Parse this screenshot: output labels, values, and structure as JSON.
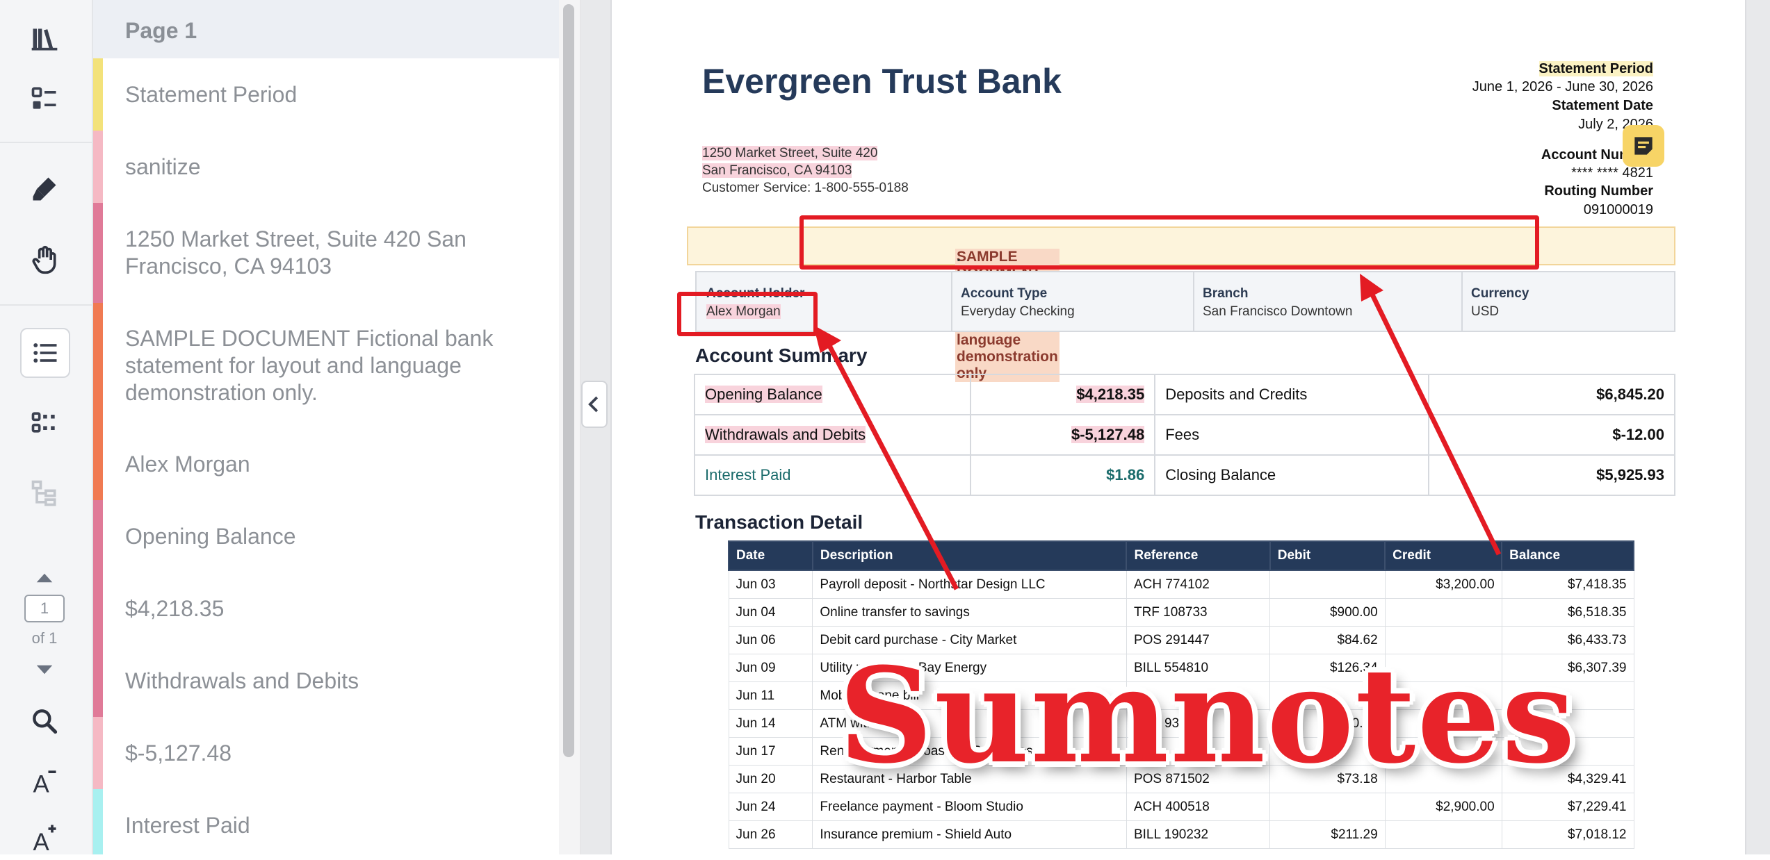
{
  "toolbar": {
    "page_number": "1",
    "page_of": "of 1",
    "icons": [
      "library-icon",
      "checklist-icon",
      "highlighter-icon",
      "hand-icon",
      "outline-list-icon",
      "grid-icon",
      "tree-icon",
      "page-up-icon",
      "page-down-icon",
      "search-icon",
      "font-decrease-icon",
      "font-increase-icon"
    ]
  },
  "outline": {
    "header": "Page 1",
    "items": [
      {
        "label": "Statement Period",
        "color": "#f3e27a"
      },
      {
        "label": "sanitize",
        "color": "#f5b9c4"
      },
      {
        "label": "1250 Market Street, Suite 420 San Francisco, CA 94103",
        "color": "#e07a98"
      },
      {
        "label": "SAMPLE DOCUMENT Fictional bank statement for layout and language demonstration only.",
        "color": "#f07a52"
      },
      {
        "label": "Alex Morgan",
        "color": "#f07a52"
      },
      {
        "label": "Opening Balance",
        "color": "#e07a98"
      },
      {
        "label": "$4,218.35",
        "color": "#e07a98"
      },
      {
        "label": "Withdrawals and Debits",
        "color": "#e07a98"
      },
      {
        "label": "$-5,127.48",
        "color": "#f5b9c4"
      },
      {
        "label": "Interest Paid",
        "color": "#a8f0f0"
      }
    ]
  },
  "doc": {
    "bank_name": "Evergreen Trust Bank",
    "address_line1": "1250 Market Street, Suite 420",
    "address_line2": "San Francisco, CA 94103",
    "customer_service": "Customer Service: 1-800-555-0188",
    "statement_period_label": "Statement Period",
    "statement_period_value": "June 1, 2026 - June 30, 2026",
    "statement_date_label": "Statement Date",
    "statement_date_value": "July 2, 2026",
    "account_number_label": "Account Number",
    "account_number_value": "**** **** 4821",
    "routing_number_label": "Routing Number",
    "routing_number_value": "091000019",
    "notice_main": "SAMPLE DOCUMENT - Fictional bank statement for layout and language demonstration only",
    "notice_end": ".",
    "info": [
      {
        "label": "Account Holder",
        "value": "Alex Morgan"
      },
      {
        "label": "Account Type",
        "value": "Everyday Checking"
      },
      {
        "label": "Branch",
        "value": "San Francisco Downtown"
      },
      {
        "label": "Currency",
        "value": "USD"
      }
    ],
    "summary_title": "Account Summary",
    "summary_rows": [
      {
        "l_label": "Opening Balance",
        "l_value": "$4,218.35",
        "r_label": "Deposits and Credits",
        "r_value": "$6,845.20"
      },
      {
        "l_label": "Withdrawals and Debits",
        "l_value": "$-5,127.48",
        "r_label": "Fees",
        "r_value": "$-12.00"
      },
      {
        "l_label": "Interest Paid",
        "l_value": "$1.86",
        "r_label": "Closing Balance",
        "r_value": "$5,925.93"
      }
    ],
    "tx_title": "Transaction Detail",
    "tx_headers": [
      "Date",
      "Description",
      "Reference",
      "Debit",
      "Credit",
      "Balance"
    ],
    "tx_rows": [
      [
        "Jun 03",
        "Payroll deposit - Northstar Design LLC",
        "ACH 774102",
        "",
        "$3,200.00",
        "$7,418.35"
      ],
      [
        "Jun 04",
        "Online transfer to savings",
        "TRF 108733",
        "$900.00",
        "",
        "$6,518.35"
      ],
      [
        "Jun 06",
        "Debit card purchase - City Market",
        "POS 291447",
        "$84.62",
        "",
        "$6,433.73"
      ],
      [
        "Jun 09",
        "Utility payment - Bay Energy",
        "BILL 554810",
        "$126.34",
        "",
        "$6,307.39"
      ],
      [
        "Jun 11",
        "Mobile phone bill",
        "",
        "",
        "",
        ""
      ],
      [
        "Jun 14",
        "ATM withdrawal",
        "ATM 930088",
        "$200.00",
        "",
        ""
      ],
      [
        "Jun 17",
        "Rent payment - Coastline Properties",
        "",
        "",
        "",
        ""
      ],
      [
        "Jun 20",
        "Restaurant - Harbor Table",
        "POS 871502",
        "$73.18",
        "",
        "$4,329.41"
      ],
      [
        "Jun 24",
        "Freelance payment - Bloom Studio",
        "ACH 400518",
        "",
        "$2,900.00",
        "$7,229.41"
      ],
      [
        "Jun 26",
        "Insurance premium - Shield Auto",
        "BILL 190232",
        "$211.29",
        "",
        "$7,018.12"
      ]
    ]
  },
  "watermark": "Sumnotes",
  "colors": {
    "navy": "#253a5a",
    "annotation_red": "#e31b23",
    "note_yellow": "#f7d466"
  }
}
